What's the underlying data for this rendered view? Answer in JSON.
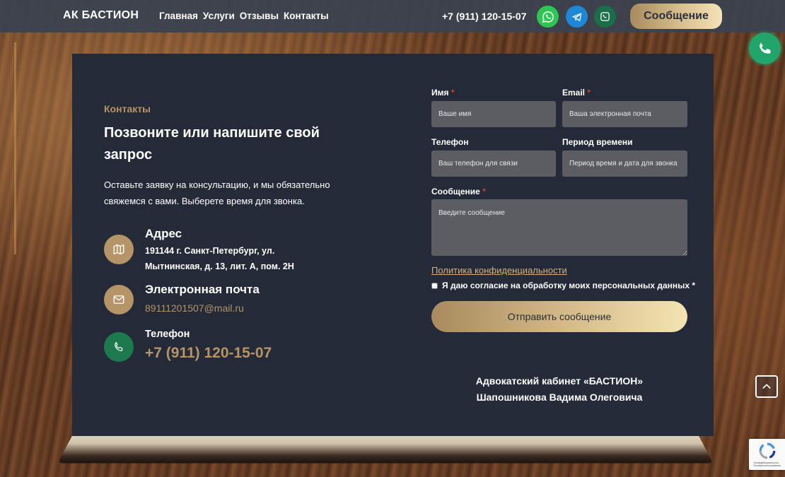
{
  "header": {
    "brand": "АК БАСТИОН",
    "nav": [
      "Главная",
      "Услуги",
      "Отзывы",
      "Контакты"
    ],
    "phone": "+7 (911) 120-15-07",
    "message_button": "Сообщение"
  },
  "contacts": {
    "eyebrow": "Контакты",
    "heading": "Позвоните или напишите свой запрос",
    "lead": "Оставьте заявку на консультацию, и мы обязательно свяжемся с вами. Выберете время для звонка.",
    "address_title": "Адрес",
    "address_text": "191144 г. Санкт-Петербург, ул. Мытнинская, д. 13, лит. А, пом. 2Н",
    "email_title": "Электронная почта",
    "email_value": "89111201507@mail.ru",
    "phone_title": "Телефон",
    "phone_value": "+7 (911) 120-15-07"
  },
  "form": {
    "name_label": "Имя",
    "name_placeholder": "Ваше имя",
    "email_label": "Email",
    "email_placeholder": "Ваша электронная почта",
    "phone_label": "Телефон",
    "phone_placeholder": "Ваш телефон для связи",
    "period_label": "Период времени",
    "period_placeholder": "Период время и дата для звонка",
    "message_label": "Сообщение",
    "message_placeholder": "Введите сообщение",
    "required_mark": "*",
    "policy_link": "Политика конфиденциальности",
    "consent_text": "Я даю согласие на обработку моих персональных данных",
    "submit": "Отправить сообщение"
  },
  "office": {
    "line1": "Адвокатский кабинет «БАСТИОН»",
    "line2": "Шапошникова Вадима Олеговича"
  },
  "recaptcha": {
    "text": "Конфиденциальность - Условия использования"
  },
  "colors": {
    "gold": "#b59468",
    "card": "#242a37",
    "whatsapp": "#2dc653",
    "telegram": "#1e88d6",
    "phone_green": "#21a56a"
  }
}
